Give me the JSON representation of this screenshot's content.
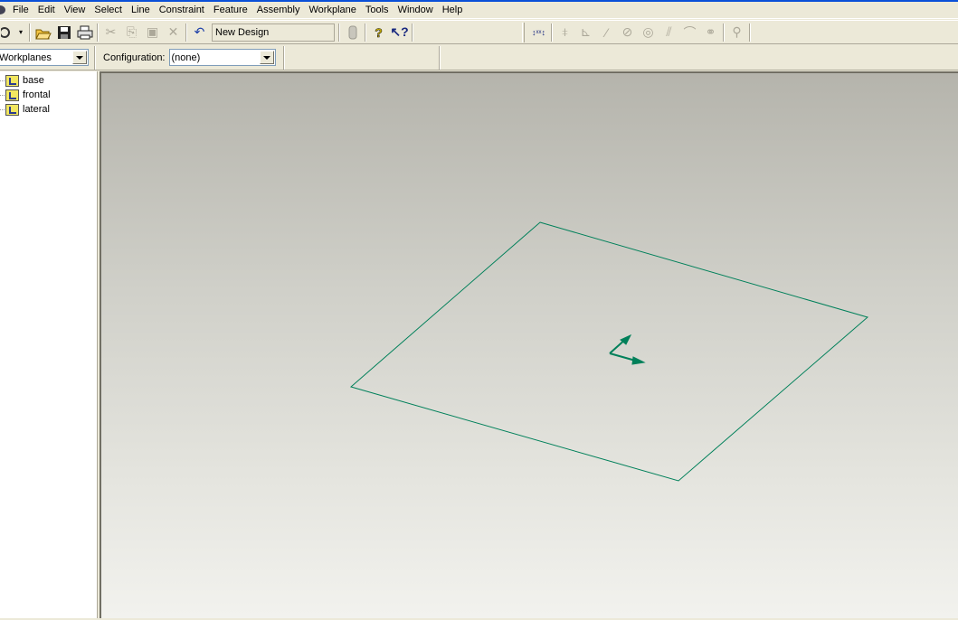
{
  "menu": {
    "items": [
      "File",
      "Edit",
      "View",
      "Select",
      "Line",
      "Constraint",
      "Feature",
      "Assembly",
      "Workplane",
      "Tools",
      "Window",
      "Help"
    ]
  },
  "toolbar": {
    "design_name": "New Design",
    "buttons": {
      "open": "open-folder-icon",
      "save": "save-icon",
      "print": "print-icon",
      "cut": "cut-icon",
      "copy": "copy-icon",
      "paste": "paste-icon",
      "delete": "delete-icon",
      "undo": "undo-icon",
      "help": "help-icon",
      "context_help": "context-help-icon"
    },
    "constraint_tools": [
      "dimension",
      "coincident",
      "perpendicular",
      "parallel-line",
      "tangent",
      "concentric",
      "parallel",
      "arc",
      "link",
      "zoom"
    ]
  },
  "browser": {
    "dropdown_value": "Workplanes",
    "items": [
      {
        "label": "base"
      },
      {
        "label": "frontal"
      },
      {
        "label": "lateral"
      }
    ]
  },
  "configuration": {
    "label": "Configuration:",
    "value": "(none)"
  },
  "viewport": {
    "accent_color": "#00805A"
  }
}
